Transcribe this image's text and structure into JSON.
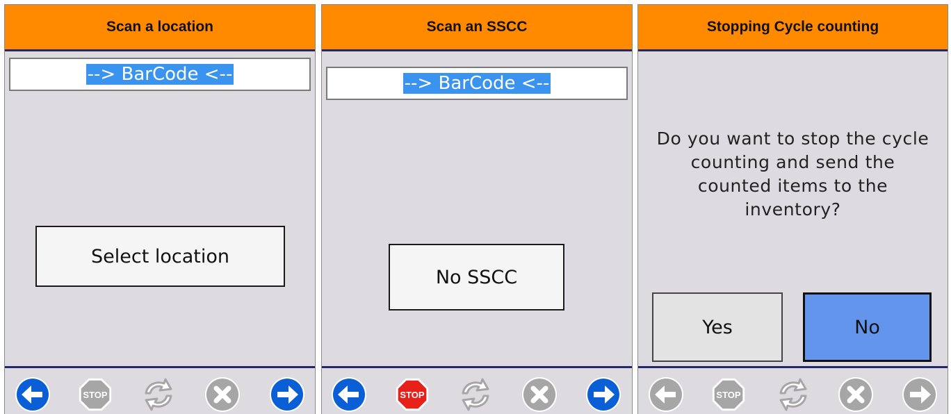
{
  "screens": [
    {
      "title": "Scan a location",
      "barcode_text": "--> BarCode <--",
      "action_label": "Select location",
      "footer": {
        "back": "active",
        "stop": "inactive",
        "refresh": "inactive",
        "cancel": "inactive",
        "forward": "active"
      }
    },
    {
      "title": "Scan an SSCC",
      "barcode_text": "--> BarCode <--",
      "action_label": "No SSCC",
      "footer": {
        "back": "active",
        "stop": "active",
        "refresh": "inactive",
        "cancel": "inactive",
        "forward": "active"
      }
    },
    {
      "title": "Stopping Cycle counting",
      "question": "Do you want to stop the cycle counting and send the counted items to the inventory?",
      "yes_label": "Yes",
      "no_label": "No",
      "footer": {
        "back": "inactive",
        "stop": "inactive",
        "refresh": "inactive",
        "cancel": "inactive",
        "forward": "inactive"
      }
    }
  ],
  "icons": {
    "back": "arrow-left-circle-icon",
    "stop": "stop-sign-icon",
    "stop_label": "STOP",
    "refresh": "refresh-arrows-icon",
    "cancel": "x-circle-icon",
    "forward": "arrow-right-circle-icon"
  },
  "colors": {
    "header": "#ff8a00",
    "header_border": "#22286b",
    "panel": "#dedbe0",
    "barcode_highlight": "#3a93ef",
    "no_button": "#6495ed",
    "arrow_active": "#0b5fd6",
    "stop_active": "#e8201a",
    "inactive": "#a6a6a6"
  }
}
